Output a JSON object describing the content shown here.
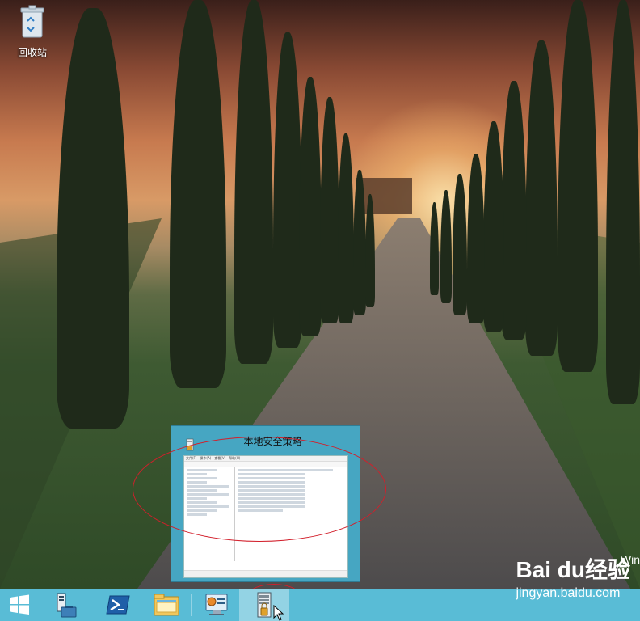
{
  "desktop": {
    "icons": [
      {
        "label": "回收站"
      }
    ]
  },
  "preview": {
    "title": "本地安全策略",
    "menu_items": [
      "文件(F)",
      "操作(A)",
      "查看(V)",
      "帮助(H)"
    ]
  },
  "taskbar": {
    "items": [
      {
        "name": "start"
      },
      {
        "name": "server-manager"
      },
      {
        "name": "powershell"
      },
      {
        "name": "file-explorer"
      },
      {
        "name": "control-panel"
      },
      {
        "name": "local-security-policy",
        "active": true
      }
    ]
  },
  "watermark": {
    "brand": "Bai du经验",
    "url": "jingyan.baidu.com",
    "partial": "Win"
  },
  "colors": {
    "taskbar": "#59bcd6",
    "preview_bg": "#46a6c2",
    "annotation": "#d21f2b"
  }
}
